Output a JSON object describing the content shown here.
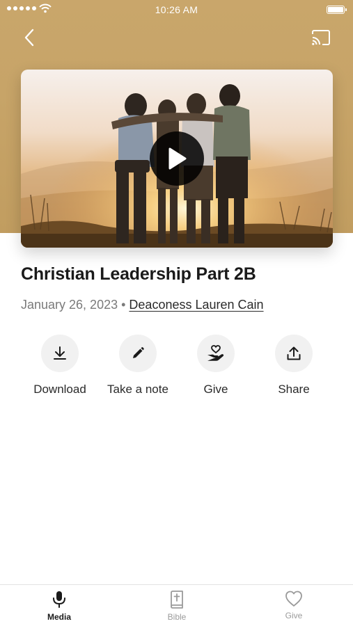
{
  "status_bar": {
    "time": "10:26 AM"
  },
  "media": {
    "title": "Christian Leadership Part 2B",
    "date": "January 26, 2023",
    "separator": "•",
    "speaker": "Deaconess Lauren Cain"
  },
  "actions": [
    {
      "label": "Download",
      "icon": "download-icon"
    },
    {
      "label": "Take a note",
      "icon": "pencil-icon"
    },
    {
      "label": "Give",
      "icon": "give-hand-heart-icon"
    },
    {
      "label": "Share",
      "icon": "share-icon"
    }
  ],
  "tab_bar": {
    "tabs": [
      {
        "label": "Media",
        "icon": "microphone-icon",
        "active": true
      },
      {
        "label": "Bible",
        "icon": "bible-icon",
        "active": false
      },
      {
        "label": "Give",
        "icon": "heart-icon",
        "active": false
      }
    ]
  },
  "colors": {
    "hero_background": "#c9a66b",
    "action_circle": "#f1f1f1",
    "tab_inactive": "#9a9a9a",
    "tab_active": "#1a1a1a"
  }
}
